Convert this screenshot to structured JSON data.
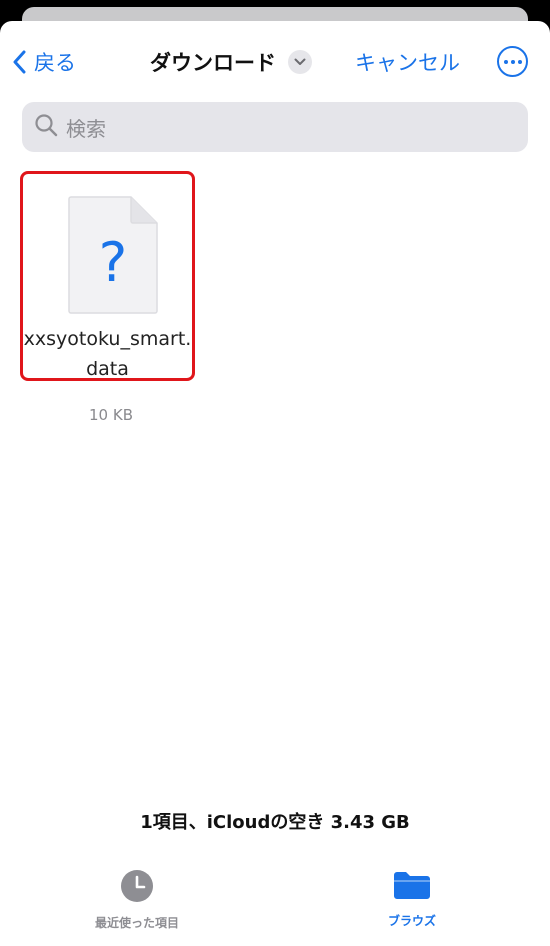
{
  "nav": {
    "back_label": "戻る",
    "title": "ダウンロード",
    "cancel_label": "キャンセル"
  },
  "search": {
    "placeholder": "検索"
  },
  "files": [
    {
      "name": "xxsyotoku_smart.data",
      "icon": "unknown-file-icon",
      "icon_glyph": "?",
      "size": "10 KB"
    }
  ],
  "footer": {
    "storage_text": "1項目、iCloudの空き 3.43 GB"
  },
  "tabbar": {
    "recent_label": "最近使った項目",
    "browse_label": "ブラウズ"
  },
  "colors": {
    "accent": "#1a73e8",
    "highlight": "#e0161b",
    "search_bg": "#e5e5ea"
  }
}
